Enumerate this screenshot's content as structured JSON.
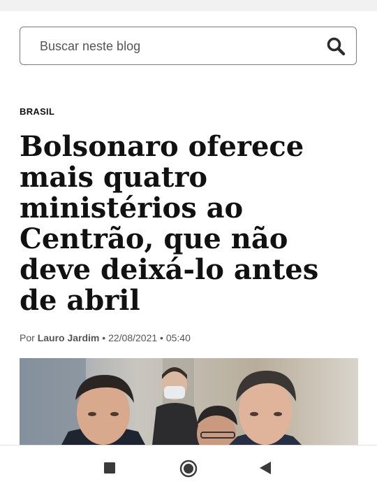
{
  "search": {
    "placeholder": "Buscar neste blog",
    "icon": "search-icon"
  },
  "article": {
    "category": "BRASIL",
    "headline": "Bolsonaro oferece mais quatro ministérios ao Centrão, que não deve deixá-lo antes de abril",
    "byline": {
      "prefix": "Por ",
      "author": "Lauro Jardim",
      "separator": " • ",
      "date": "22/08/2021",
      "time": "05:40"
    },
    "photo": "news-photo"
  },
  "system_nav": {
    "buttons": [
      "recent-apps",
      "home",
      "back"
    ]
  },
  "colors": {
    "background": "#ffffff",
    "text": "#111111",
    "meta_text": "#555555",
    "nav_icons": "#3a3a3a"
  }
}
